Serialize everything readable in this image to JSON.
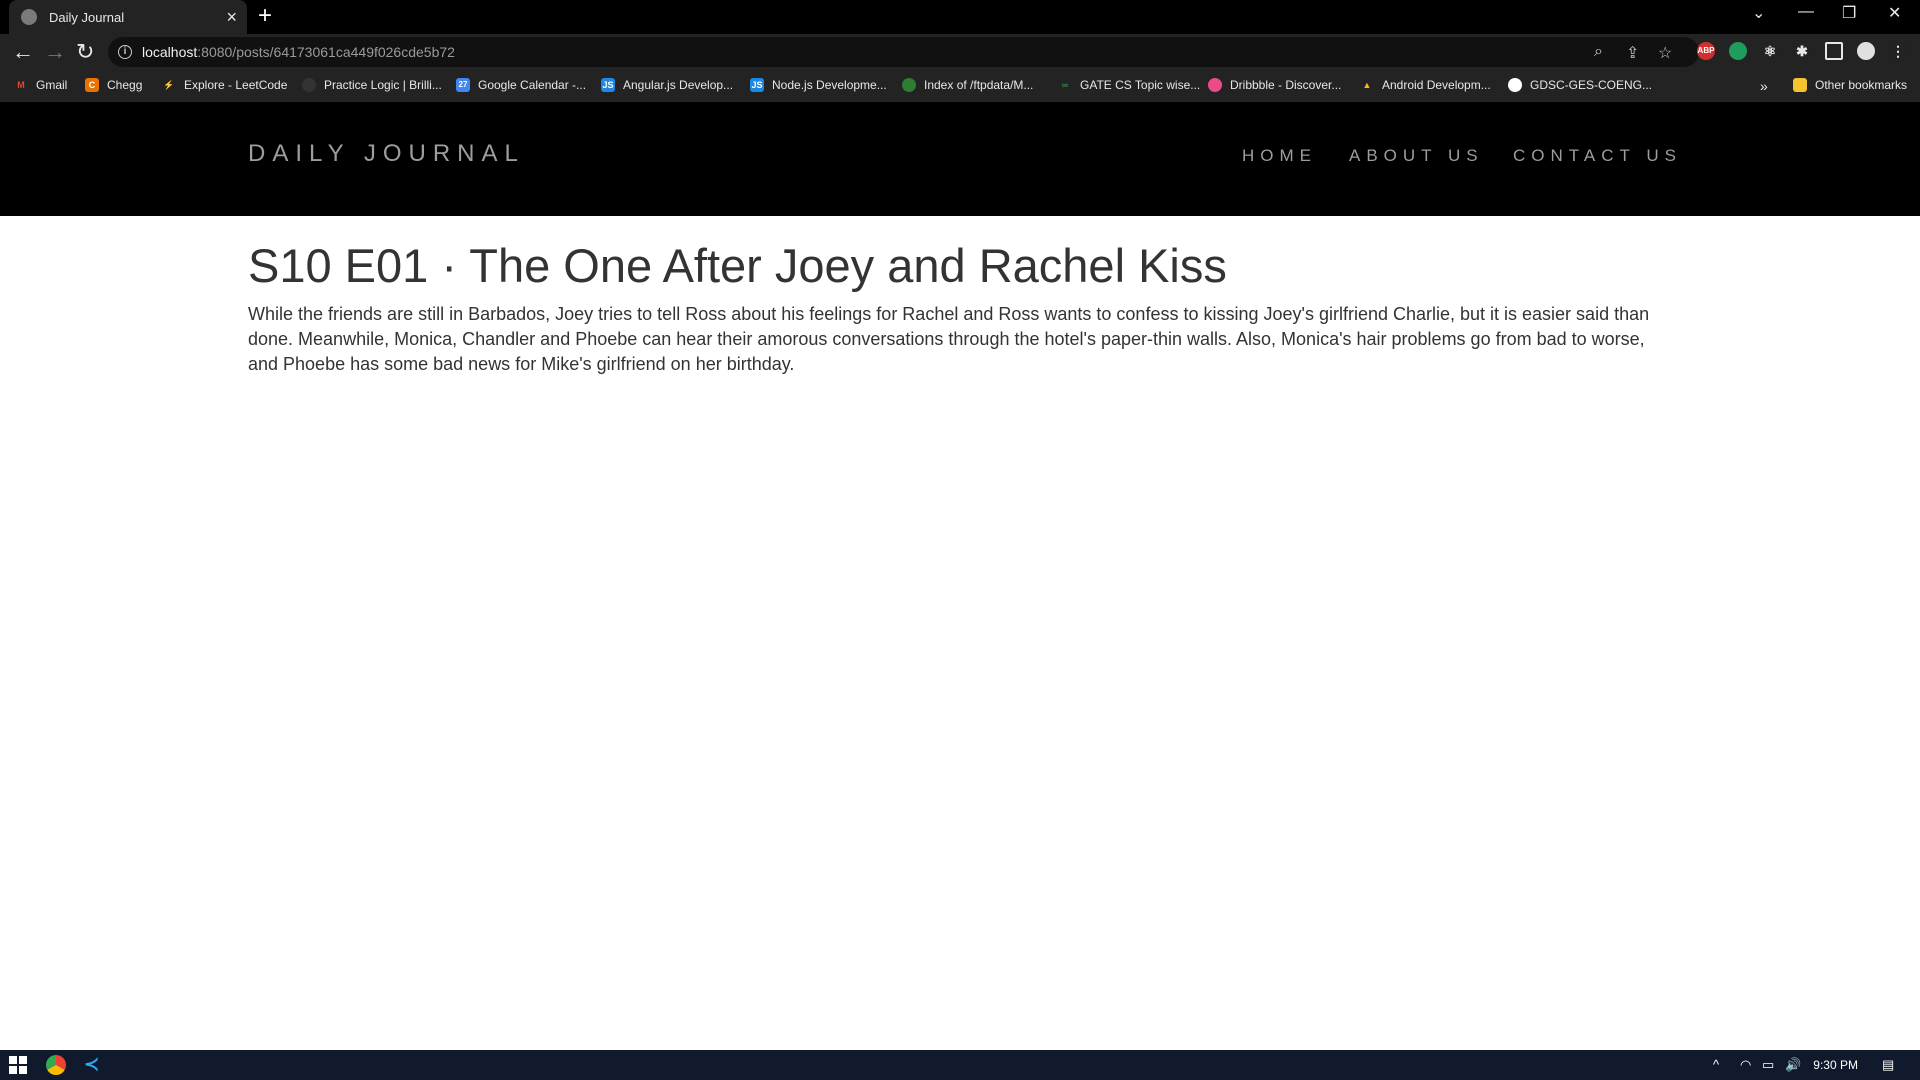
{
  "browser": {
    "tab_title": "Daily Journal",
    "url_host": "localhost",
    "url_rest": ":8080/posts/64173061ca449f026cde5b72",
    "bookmarks": [
      {
        "label": "Gmail",
        "icon": "gmail-icon",
        "color": "#ea4335",
        "glyph": "M"
      },
      {
        "label": "Chegg",
        "icon": "chegg-icon",
        "color": "#eb7100",
        "glyph": "C"
      },
      {
        "label": "Explore - LeetCode",
        "icon": "leetcode-icon",
        "color": "#3a3a3a",
        "glyph": "L"
      },
      {
        "label": "Practice Logic | Brilli...",
        "icon": "brilliant-icon",
        "color": "#333333",
        "glyph": ""
      },
      {
        "label": "Google Calendar -...",
        "icon": "calendar-icon",
        "color": "#4285f4",
        "glyph": "27"
      },
      {
        "label": "Angular.js Develop...",
        "icon": "js-icon",
        "color": "#1e88e5",
        "glyph": "JS"
      },
      {
        "label": "Node.js Developme...",
        "icon": "js-icon",
        "color": "#1e88e5",
        "glyph": "JS"
      },
      {
        "label": "Index of /ftpdata/M...",
        "icon": "globe-icon",
        "color": "#2e7d32",
        "glyph": ""
      },
      {
        "label": "GATE CS Topic wise...",
        "icon": "geeks-icon",
        "color": "#2f8d46",
        "glyph": "G"
      },
      {
        "label": "Dribbble - Discover...",
        "icon": "dribbble-icon",
        "color": "#ea4c89",
        "glyph": ""
      },
      {
        "label": "Android Developm...",
        "icon": "drive-icon",
        "color": "#fbbc04",
        "glyph": ""
      },
      {
        "label": "GDSC-GES-COENG...",
        "icon": "github-icon",
        "color": "#ffffff",
        "glyph": ""
      }
    ],
    "other_bookmarks": "Other bookmarks"
  },
  "site": {
    "brand": "DAILY JOURNAL",
    "nav": [
      "HOME",
      "ABOUT US",
      "CONTACT US"
    ]
  },
  "post": {
    "title": "S10 E01 · The One After Joey and Rachel Kiss",
    "body": "While the friends are still in Barbados, Joey tries to tell Ross about his feelings for Rachel and Ross wants to confess to kissing Joey's girlfriend Charlie, but it is easier said than done. Meanwhile, Monica, Chandler and Phoebe can hear their amorous conversations through the hotel's paper-thin walls. Also, Monica's hair problems go from bad to worse, and Phoebe has some bad news for Mike's girlfriend on her birthday."
  },
  "taskbar": {
    "time": "9:30 PM"
  }
}
